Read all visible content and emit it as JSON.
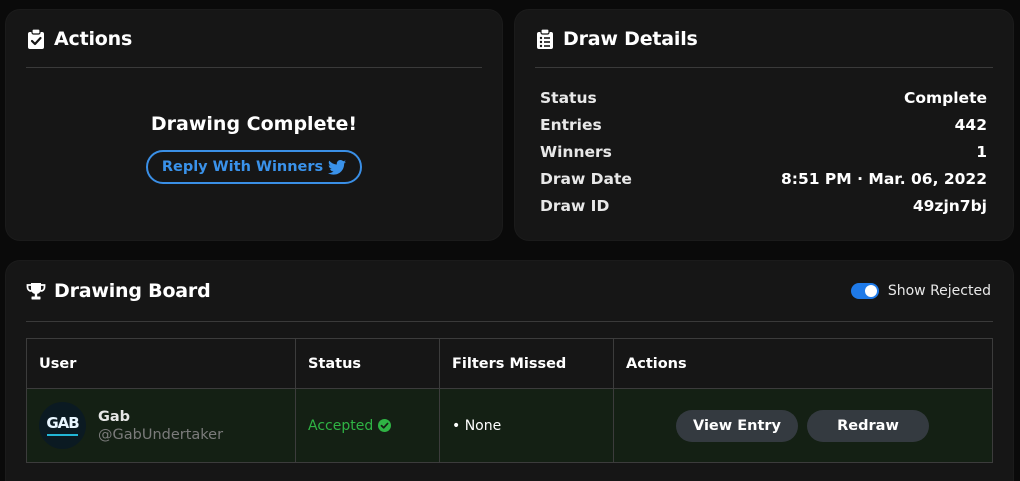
{
  "actions_card": {
    "title": "Actions",
    "icon": "clipboard-check-icon",
    "status_message": "Drawing Complete!",
    "reply_button": "Reply With Winners",
    "reply_icon": "twitter-icon",
    "accent_color": "#3a8fe6"
  },
  "details_card": {
    "title": "Draw Details",
    "icon": "clipboard-list-icon",
    "rows": [
      {
        "label": "Status",
        "value": "Complete"
      },
      {
        "label": "Entries",
        "value": "442"
      },
      {
        "label": "Winners",
        "value": "1"
      },
      {
        "label": "Draw Date",
        "value": "8:51 PM · Mar. 06, 2022"
      },
      {
        "label": "Draw ID",
        "value": "49zjn7bj"
      }
    ]
  },
  "board": {
    "title": "Drawing Board",
    "icon": "trophy-icon",
    "toggle_label": "Show Rejected",
    "toggle_on": true,
    "columns": [
      "User",
      "Status",
      "Filters Missed",
      "Actions"
    ],
    "rows": [
      {
        "name": "Gab",
        "handle": "@GabUndertaker",
        "avatar_text": "GAB",
        "status": "Accepted",
        "status_color": "#2fb344",
        "filters_missed": "• None",
        "view_button": "View Entry",
        "redraw_button": "Redraw"
      }
    ]
  }
}
